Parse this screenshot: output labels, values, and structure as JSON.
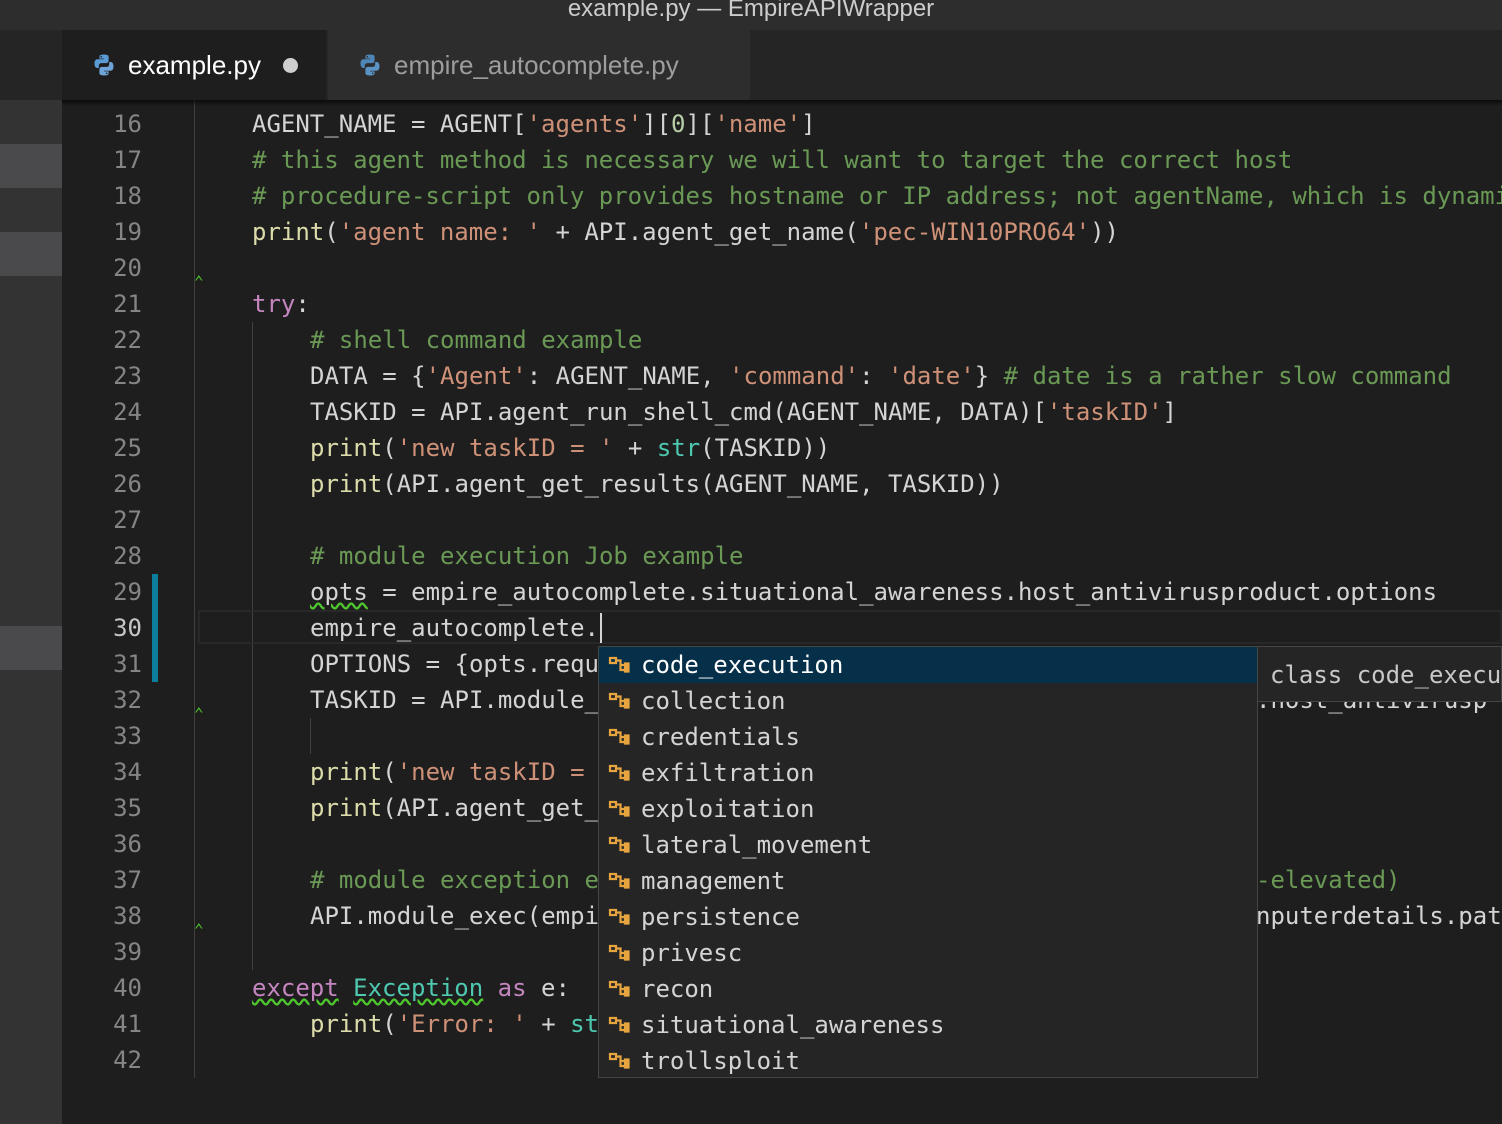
{
  "window": {
    "title": "example.py — EmpireAPIWrapper"
  },
  "tabs": [
    {
      "label": "example.py",
      "active": true,
      "dirty": true
    },
    {
      "label": "empire_autocomplete.py",
      "active": false
    }
  ],
  "editor": {
    "line_numbers": [
      "16",
      "17",
      "18",
      "19",
      "20",
      "21",
      "22",
      "23",
      "24",
      "25",
      "26",
      "27",
      "28",
      "29",
      "30",
      "31",
      "32",
      "33",
      "34",
      "35",
      "36",
      "37",
      "38",
      "39",
      "40",
      "41",
      "42"
    ],
    "lines": {
      "l16": {
        "a": "AGENT_NAME = AGENT[",
        "s1": "'agents'",
        "b": "][",
        "n1": "0",
        "c": "][",
        "s2": "'name'",
        "d": "]"
      },
      "l17": {
        "cm": "# this agent method is necessary we will want to target the correct host"
      },
      "l18": {
        "cm": "# procedure-script only provides hostname or IP address; not agentName, which is dynami"
      },
      "l19": {
        "fn": "print",
        "a": "(",
        "s1": "'agent name: '",
        "b": " + API.agent_get_name(",
        "s2": "'pec-WIN10PRO64'",
        "c": "))"
      },
      "l21": {
        "kw": "try",
        "a": ":"
      },
      "l22": {
        "cm": "# shell command example"
      },
      "l23": {
        "a": "DATA = {",
        "s1": "'Agent'",
        "b": ": AGENT_NAME, ",
        "s2": "'command'",
        "c": ": ",
        "s3": "'date'",
        "d": "} ",
        "cm": "# date is a rather slow command"
      },
      "l24": {
        "a": "TASKID = API.agent_run_shell_cmd(AGENT_NAME, DATA)[",
        "s1": "'taskID'",
        "b": "]"
      },
      "l25": {
        "fn": "print",
        "a": "(",
        "s1": "'new taskID = '",
        "b": " + ",
        "cls": "str",
        "c": "(TASKID))"
      },
      "l26": {
        "fn": "print",
        "a": "(API.agent_get_results(AGENT_NAME, TASKID))"
      },
      "l28": {
        "cm": "# module execution Job example"
      },
      "l29": {
        "w": "opts",
        "a": " = empire_autocomplete.situational_awareness.host_antivirusproduct.options"
      },
      "l30": {
        "a": "empire_autocomplete."
      },
      "l31": {
        "a": "OPTIONS = {opts.requ"
      },
      "l32": {
        "a": "TASKID = API.module_"
      },
      "l34": {
        "fn": "print",
        "a": "(",
        "s1": "'new taskID = "
      },
      "l35": {
        "fn": "print",
        "a": "(API.agent_get_"
      },
      "l37": {
        "cm": "# module exception e"
      },
      "l38": {
        "a": "API.module_exec(empi"
      },
      "l40": {
        "kw": "except",
        "a": " ",
        "cls": "Exception",
        "b": " ",
        "kw2": "as",
        "c": " e:"
      },
      "l41": {
        "fn": "print",
        "a": "(",
        "s1": "'Error: '",
        "b": " + ",
        "cls": "st"
      }
    },
    "peek_fragments": {
      "r32": ".host_antivirusp",
      "r37": "-elevated)",
      "r38": "nputerdetails.path"
    }
  },
  "suggest": {
    "items": [
      "code_execution",
      "collection",
      "credentials",
      "exfiltration",
      "exploitation",
      "lateral_movement",
      "management",
      "persistence",
      "privesc",
      "recon",
      "situational_awareness",
      "trollsploit"
    ],
    "selected": "code_execution",
    "icon": "module-icon",
    "details": "class code_execution"
  },
  "colors": {
    "background": "#1e1e1e",
    "keyword": "#c586c0",
    "function": "#dcdcaa",
    "string": "#ce9178",
    "comment": "#6a9955",
    "type": "#4ec9b0",
    "suggest_selected": "#062f4a",
    "modified_bar": "#0c7d9d"
  }
}
